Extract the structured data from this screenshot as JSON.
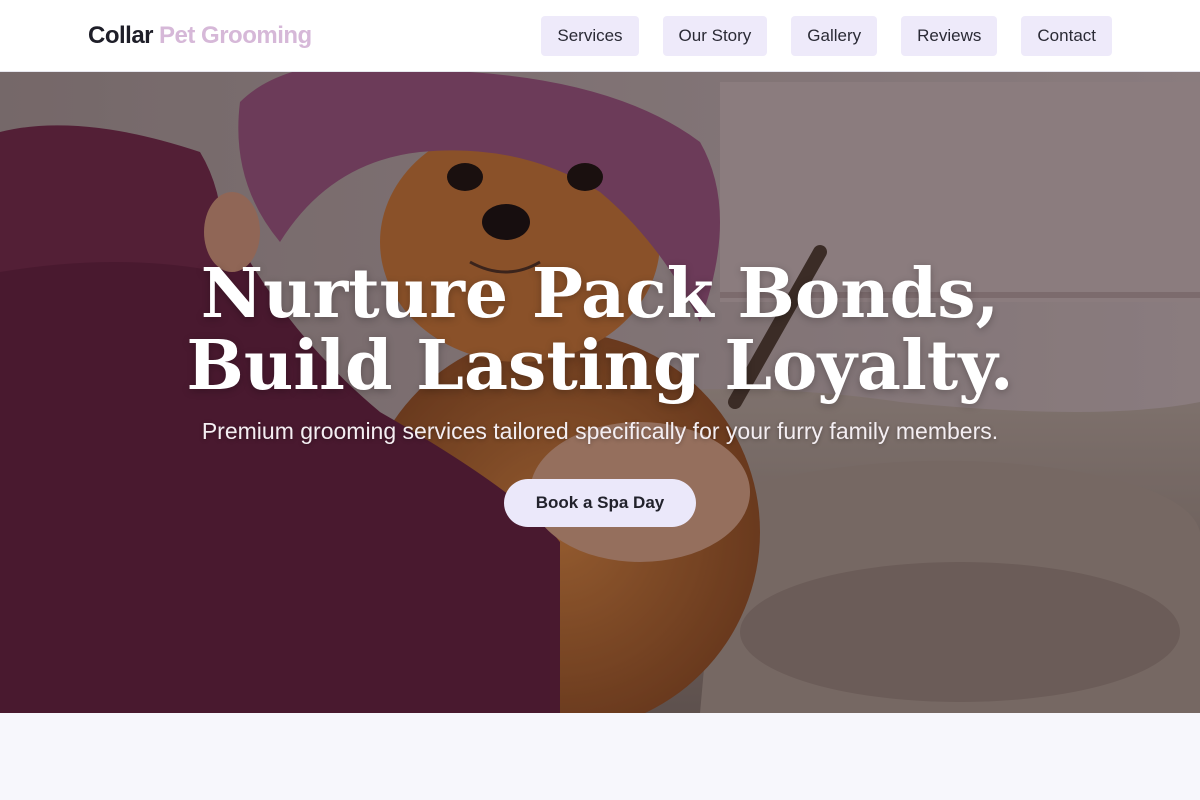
{
  "header": {
    "logo_main": "Collar",
    "logo_sub": "Pet Grooming",
    "nav": [
      "Services",
      "Our Story",
      "Gallery",
      "Reviews",
      "Contact"
    ]
  },
  "hero": {
    "headline_line1": "Nurture Pack Bonds,",
    "headline_line2": "Build Lasting Loyalty.",
    "subheadline": "Premium grooming services tailored specifically for your furry family members.",
    "cta_label": "Book a Spa Day",
    "image_alt": "pomeranian-with-towel-being-combed"
  },
  "colors": {
    "brand_dark": "#1e1e28",
    "brand_accent": "#d6b8d8",
    "nav_button_bg": "#eeeafa",
    "cta_bg": "#ebe8fa",
    "page_bg": "#f7f7fc"
  }
}
